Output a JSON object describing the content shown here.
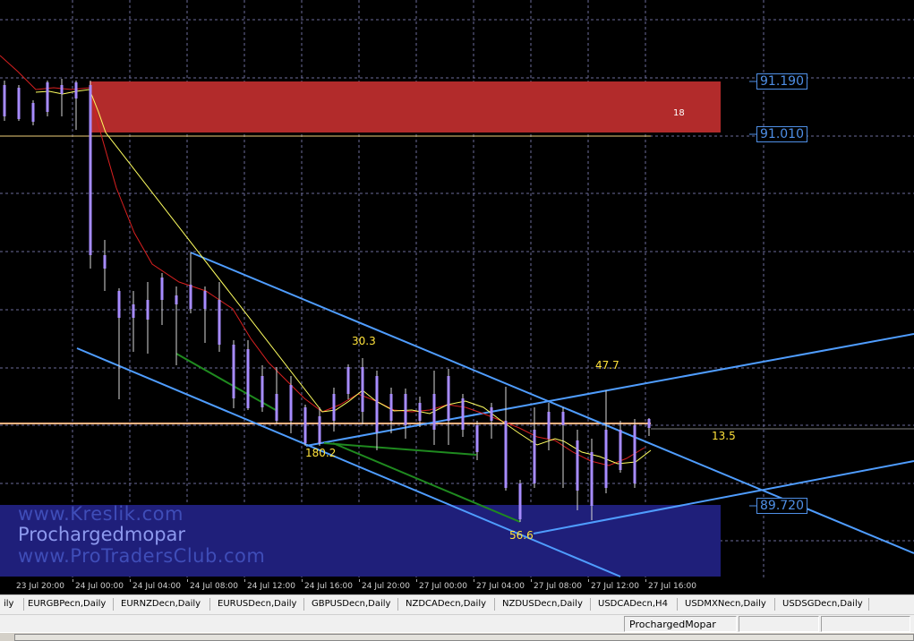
{
  "chart": {
    "zone_label": "18",
    "watermarks": [
      "www.Kreslik.com",
      "Prochargedmopar",
      "www.ProTradersClub.com"
    ],
    "annotations": [
      "30.3",
      "47.7",
      "13.5",
      "180.2",
      "56.6"
    ],
    "colors": {
      "background": "#000000",
      "grid": "#6b6b9a",
      "bullish_candle": "#4a8fff",
      "bearish_candle": "#d8d8d8",
      "channel_line": "#4f9dff",
      "supply_zone": "#b22b2b",
      "demand_zone": "#1f1f7a",
      "ma_red": "#d82020",
      "ma_yellow": "#ffff60",
      "trend_green": "#1f8a1f",
      "price_line": "#ffb380",
      "annotation_text": "#ffe23b"
    }
  },
  "price_axis": {
    "labels": [
      "91.190",
      "91.010",
      "89.720"
    ]
  },
  "time_axis": {
    "labels": [
      "23 Jul 20:00",
      "24 Jul 00:00",
      "24 Jul 04:00",
      "24 Jul 08:00",
      "24 Jul 12:00",
      "24 Jul 16:00",
      "24 Jul 20:00",
      "27 Jul 00:00",
      "27 Jul 04:00",
      "27 Jul 08:00",
      "27 Jul 12:00",
      "27 Jul 16:00"
    ]
  },
  "tabs": [
    "EURGBPecn,Daily",
    "EURNZDecn,Daily",
    "EURUSDecn,Daily",
    "GBPUSDecn,Daily",
    "NZDCADecn,Daily",
    "NZDUSDecn,Daily",
    "USDCADecn,H4",
    "USDMXNecn,Daily",
    "USDSGDecn,Daily"
  ],
  "status": {
    "profile": "ProchargedMopar"
  }
}
